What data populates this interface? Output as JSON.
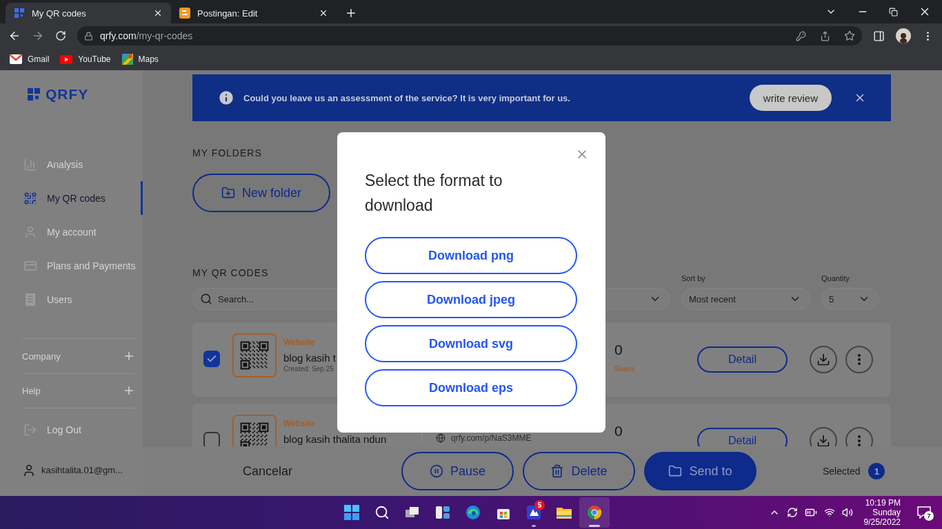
{
  "browser": {
    "tabs": [
      {
        "title": "My QR codes",
        "kind": "qrfy",
        "selected": true
      },
      {
        "title": "Postingan: Edit",
        "kind": "blogger",
        "selected": false
      }
    ],
    "url": {
      "domain": "qrfy.com",
      "path": "/my-qr-codes"
    },
    "bookmarks": [
      {
        "label": "Gmail",
        "kind": "gmail"
      },
      {
        "label": "YouTube",
        "kind": "youtube"
      },
      {
        "label": "Maps",
        "kind": "maps"
      }
    ]
  },
  "sidebar": {
    "logo": "QRFY",
    "nav": [
      {
        "label": "Analysis",
        "kind": "chart",
        "selected": false
      },
      {
        "label": "My QR codes",
        "kind": "qr",
        "selected": true
      },
      {
        "label": "My account",
        "kind": "user",
        "selected": false
      },
      {
        "label": "Plans and Payments",
        "kind": "card",
        "selected": false
      },
      {
        "label": "Users",
        "kind": "list",
        "selected": false
      }
    ],
    "sections": [
      {
        "label": "Company",
        "expanded": false
      },
      {
        "label": "Help",
        "expanded": false
      }
    ],
    "logout": "Log Out",
    "user": "kasihtalita.01@gm..."
  },
  "banner": {
    "message": "Could you leave us an assessment of the service? It is very important for us.",
    "button": "write review"
  },
  "folders": {
    "heading": "MY FOLDERS",
    "new_folder": "New folder"
  },
  "qr_codes": {
    "heading": "MY QR CODES",
    "search": {
      "placeholder": "Search..."
    },
    "sort": {
      "label": "Sort by",
      "value": "Most recent"
    },
    "quantity": {
      "label": "Quantity",
      "value": "5"
    },
    "rows": [
      {
        "checked": true,
        "type": "Website",
        "name": "blog kasih t",
        "created": "Created: Sep 25",
        "count": "0",
        "count_label": "Scans",
        "detail": "Detail"
      },
      {
        "checked": false,
        "type": "Website",
        "name": "blog kasih thalita ndun",
        "link": "qrfy.com/p/NaS3MME",
        "count": "0",
        "detail": "Detail"
      }
    ]
  },
  "action_bar": {
    "cancel": "Cancelar",
    "buttons": [
      {
        "label": "Pause",
        "kind": "pause",
        "primary": false
      },
      {
        "label": "Delete",
        "kind": "delete",
        "primary": false
      },
      {
        "label": "Send to",
        "kind": "send",
        "primary": true
      }
    ],
    "selected_label": "Selected",
    "selected_count": "1"
  },
  "modal": {
    "title": "Select the format to download",
    "options": [
      "Download png",
      "Download jpeg",
      "Download svg",
      "Download eps"
    ]
  },
  "taskbar": {
    "apps": [
      {
        "kind": "start",
        "running": false,
        "active": false
      },
      {
        "kind": "search",
        "running": false,
        "active": false
      },
      {
        "kind": "taskview",
        "running": false,
        "active": false
      },
      {
        "kind": "widgets",
        "running": false,
        "active": false
      },
      {
        "kind": "edge",
        "running": false,
        "active": false
      },
      {
        "kind": "store",
        "running": false,
        "active": false
      },
      {
        "kind": "app",
        "badge": "5",
        "running": true,
        "active": false
      },
      {
        "kind": "explorer",
        "running": false,
        "active": false
      },
      {
        "kind": "chrome",
        "running": true,
        "active": true
      }
    ],
    "time": "10:19 PM",
    "day": "Sunday",
    "date": "9/25/2022",
    "notifications": "7"
  }
}
